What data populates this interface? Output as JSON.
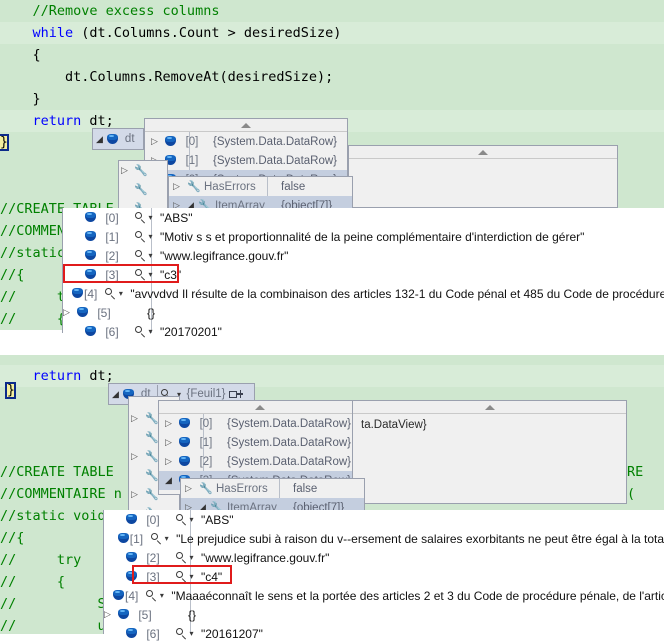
{
  "editor": {
    "background_color": "#cfe7cf",
    "keyword_color": "#0000ff",
    "comment_color": "#008000",
    "highlight_color": "#d8ecd8",
    "brace_marker": "}",
    "top_pane_lines": [
      "    //Remove excess columns",
      "    while (dt.Columns.Count > desiredSize)",
      "    {",
      "        dt.Columns.RemoveAt(desiredSize);",
      "    }",
      "",
      "    return dt;",
      "}",
      "",
      "//CREATE TABLE",
      "//COMMENTAIRE n",
      "//static void l",
      "//{",
      "//     try",
      "//     {"
    ],
    "bottom_pane_lines": [
      "    return dt;",
      "}",
      "",
      "",
      "//CREATE TABLE",
      "//COMMENTAIRE n",
      "//static void l",
      "//{",
      "//     try",
      "//     {",
      "//          St",
      "//          us"
    ],
    "bottom_right_fragments": [
      "RE",
      "("
    ]
  },
  "tooltip_top": {
    "name": "dt",
    "expander": "expanded",
    "icon": "object-icon",
    "rows": [
      {
        "index": "[0]",
        "value": "{System.Data.DataRow}",
        "expander": "closed",
        "selected": false
      },
      {
        "index": "[1]",
        "value": "{System.Data.DataRow}",
        "expander": "closed",
        "selected": false
      },
      {
        "index": "[2]",
        "value": "{System.Data.DataRow}",
        "expander": "expanded",
        "selected": true
      }
    ],
    "members": [
      {
        "name": "HasErrors",
        "value": "false",
        "expander": "closed",
        "selected": false
      },
      {
        "name": "ItemArray",
        "value": "{object[7]}",
        "expander": "expanded",
        "selected": true
      }
    ],
    "item_array": [
      {
        "index": "[0]",
        "value": "\"ABS\"",
        "magnifier": true,
        "expander": false
      },
      {
        "index": "[1]",
        "value": "\"Motiv s s et proportionnalité de la peine complémentaire d'interdiction de gérer\"",
        "magnifier": true,
        "expander": false
      },
      {
        "index": "[2]",
        "value": "\"www.legifrance.gouv.fr\"",
        "magnifier": true,
        "expander": false
      },
      {
        "index": "[3]",
        "value": "\"c3\"",
        "magnifier": true,
        "expander": false,
        "highlighted": true
      },
      {
        "index": "[4]",
        "value": "\"avvvdvd Il résulte de la combinaison des articles 132-1 du Code pénal et 485 du Code de procédure",
        "magnifier": true,
        "expander": false
      },
      {
        "index": "[5]",
        "value": "{}",
        "magnifier": false,
        "expander": true
      },
      {
        "index": "[6]",
        "value": "\"20170201\"",
        "magnifier": true,
        "expander": false
      }
    ]
  },
  "tooltip_bottom": {
    "name": "dt",
    "value": "{Feuil1}",
    "expander": "expanded",
    "icon": "object-icon",
    "magnifier": true,
    "pin_icon": "pin-icon",
    "rows": [
      {
        "index": "[0]",
        "value": "{System.Data.DataRow}",
        "expander": "closed",
        "selected": false
      },
      {
        "index": "[1]",
        "value": "{System.Data.DataRow}",
        "expander": "closed",
        "selected": false
      },
      {
        "index": "[2]",
        "value": "{System.Data.DataRow}",
        "expander": "closed",
        "selected": false
      },
      {
        "index": "[3]",
        "value": "{System.Data.DataRow}",
        "expander": "expanded",
        "selected": true
      }
    ],
    "members": [
      {
        "name": "HasErrors",
        "value": "false",
        "expander": "closed",
        "selected": false
      },
      {
        "name": "ItemArray",
        "value": "{object[7]}",
        "expander": "expanded",
        "selected": true
      }
    ],
    "item_array": [
      {
        "index": "[0]",
        "value": "\"ABS\"",
        "magnifier": true,
        "expander": false
      },
      {
        "index": "[1]",
        "value": "\"Le prejudice subi à raison du v--ersement de salaires exorbitants ne peut être égal à la tota",
        "magnifier": true,
        "expander": false
      },
      {
        "index": "[2]",
        "value": "\"www.legifrance.gouv.fr\"",
        "magnifier": true,
        "expander": false
      },
      {
        "index": "[3]",
        "value": "\"c4\"",
        "magnifier": true,
        "expander": false,
        "highlighted": true
      },
      {
        "index": "[4]",
        "value": "\"Maaaéconnaît le sens et la portée des articles 2 et 3 du Code de procédure pénale, de l'artic",
        "magnifier": true,
        "expander": false
      },
      {
        "index": "[5]",
        "value": "{}",
        "magnifier": false,
        "expander": true
      },
      {
        "index": "[6]",
        "value": "\"20161207\"",
        "magnifier": true,
        "expander": false
      }
    ],
    "dataview_panel_value": "ta.DataView}"
  },
  "colors": {
    "highlight_box": "#e01b1b",
    "selection": "#c4cedf",
    "tooltip_bg": "#f0f0f0",
    "header_bg": "#d3dae8"
  }
}
